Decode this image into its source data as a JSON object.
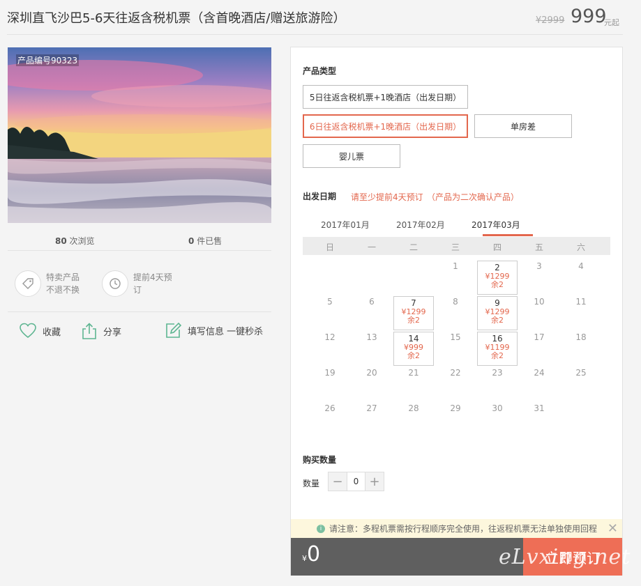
{
  "header": {
    "title": "深圳直飞沙巴5-6天往返含税机票（含首晚酒店/赠送旅游险）",
    "price_original": "¥2999",
    "price": "999",
    "price_unit": "元起"
  },
  "gallery": {
    "product_code": "产品编号90323"
  },
  "stats": {
    "views_count": "80",
    "views_label": "次浏览",
    "sold_count": "0",
    "sold_label": "件已售"
  },
  "features": [
    {
      "icon": "tag-icon",
      "line1": "特卖产品",
      "line2": "不退不换"
    },
    {
      "icon": "clock-icon",
      "line1": "提前4天预",
      "line2": "订"
    }
  ],
  "actions": {
    "favorite": "收藏",
    "share": "分享",
    "fill_info": "填写信息 一键秒杀"
  },
  "product_type": {
    "label": "产品类型",
    "options": [
      "5日往返含税机票+1晚酒店（出发日期）",
      "6日往返含税机票+1晚酒店（出发日期）",
      "单房差",
      "婴儿票"
    ],
    "selected_index": 1
  },
  "departure": {
    "label": "出发日期",
    "note1": "请至少提前4天预订",
    "note2": "（产品为二次确认产品）"
  },
  "calendar": {
    "months": [
      "2017年01月",
      "2017年02月",
      "2017年03月"
    ],
    "active_month_index": 2,
    "weekdays": [
      "日",
      "一",
      "二",
      "三",
      "四",
      "五",
      "六"
    ],
    "first_weekday": 3,
    "days_in_month": 31,
    "available": [
      {
        "day": "2",
        "price": "¥1299",
        "remain": "余2"
      },
      {
        "day": "7",
        "price": "¥1299",
        "remain": "余2"
      },
      {
        "day": "9",
        "price": "¥1299",
        "remain": "余2"
      },
      {
        "day": "14",
        "price": "¥999",
        "remain": "余2"
      },
      {
        "day": "16",
        "price": "¥1199",
        "remain": "余2"
      }
    ]
  },
  "quantity": {
    "section_label": "购买数量",
    "label": "数量",
    "minus": "−",
    "value": "0",
    "plus": "+"
  },
  "notice": {
    "text": "请注意：多程机票需按行程顺序完全使用，往返程机票无法单独使用回程",
    "close": "✕"
  },
  "checkout": {
    "currency": "¥",
    "total": "0",
    "book_label": "立即预订"
  },
  "watermark": "eLvxing.net"
}
